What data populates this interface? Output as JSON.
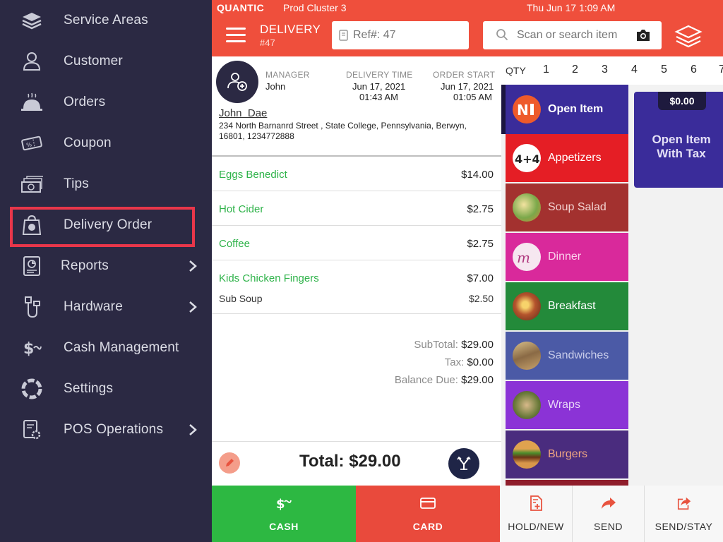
{
  "colors": {
    "sidebar_bg": "#2b2943",
    "header_bg": "#ef4f3c",
    "accent_green": "#2fb34a",
    "highlight_red": "#e8364a",
    "cash_green": "#2db842",
    "card_red": "#e94a3c"
  },
  "sidebar": {
    "items": [
      {
        "label": "Service Areas",
        "icon": "layers-icon",
        "chevron": false
      },
      {
        "label": "Customer",
        "icon": "user-icon",
        "chevron": false
      },
      {
        "label": "Orders",
        "icon": "cloche-icon",
        "chevron": false
      },
      {
        "label": "Coupon",
        "icon": "coupon-icon",
        "chevron": false
      },
      {
        "label": "Tips",
        "icon": "cash-stack-icon",
        "chevron": false
      },
      {
        "label": "Delivery Order",
        "icon": "delivery-bag-icon",
        "chevron": false,
        "highlighted": true
      },
      {
        "label": "Reports",
        "icon": "report-icon",
        "chevron": true
      },
      {
        "label": "Hardware",
        "icon": "plug-icon",
        "chevron": true
      },
      {
        "label": "Cash Management",
        "icon": "dollar-icon",
        "chevron": false
      },
      {
        "label": "Settings",
        "icon": "lifebuoy-icon",
        "chevron": false
      },
      {
        "label": "POS Operations",
        "icon": "pos-settings-icon",
        "chevron": true
      }
    ]
  },
  "status_bar": {
    "brand": "QUANTIC",
    "cluster": "Prod Cluster 3",
    "datetime": "Thu Jun 17 1:09 AM"
  },
  "header": {
    "mode": "DELIVERY",
    "order_number": "#47",
    "ref_placeholder": "Ref#: 47",
    "search_placeholder": "Scan or search item"
  },
  "order": {
    "manager_label": "MANAGER",
    "manager": "John",
    "delivery_time_label": "DELIVERY TIME",
    "delivery_date": "Jun 17, 2021",
    "delivery_time": "01:43 AM",
    "order_start_label": "ORDER START",
    "order_start_date": "Jun 17, 2021",
    "order_start_time": "01:05 AM",
    "customer_name": "John  Dae",
    "customer_address": "234 North Barnanrd Street , State College, Pennsylvania, Berwyn, 16801, 1234772888",
    "items": [
      {
        "name": "Eggs Benedict",
        "price": "$14.00"
      },
      {
        "name": "Hot Cider",
        "price": "$2.75"
      },
      {
        "name": "Coffee",
        "price": "$2.75"
      },
      {
        "name": "Kids Chicken Fingers",
        "price": "$7.00"
      }
    ],
    "modifier": {
      "name": "Sub Soup",
      "price": "$2.50"
    },
    "subtotal_label": "SubTotal:",
    "subtotal": "$29.00",
    "tax_label": "Tax:",
    "tax": "$0.00",
    "balance_label": "Balance Due:",
    "balance": "$29.00",
    "total": "Total: $29.00"
  },
  "qty": {
    "label": "QTY",
    "numbers": [
      "1",
      "2",
      "3",
      "4",
      "5",
      "6",
      "7"
    ]
  },
  "categories": [
    {
      "label": "Open Item",
      "bg": "#3a2c9a",
      "text": "#ffffff",
      "bold": true,
      "selected": true
    },
    {
      "label": "Appetizers",
      "bg": "#e51e25",
      "text": "#ffffff",
      "bold": false
    },
    {
      "label": "Soup Salad",
      "bg": "#a3312f",
      "text": "#f2d2d0",
      "bold": false
    },
    {
      "label": "Dinner",
      "bg": "#d9299b",
      "text": "#fbd3ec",
      "bold": false
    },
    {
      "label": "Breakfast",
      "bg": "#238a3a",
      "text": "#ffffff",
      "bold": false
    },
    {
      "label": "Sandwiches",
      "bg": "#4b5aa6",
      "text": "#c9cdea",
      "bold": false
    },
    {
      "label": "Wraps",
      "bg": "#8b33d6",
      "text": "#e7d6f7",
      "bold": false
    },
    {
      "label": "Burgers",
      "bg": "#4a2c7e",
      "text": "#f0a582",
      "bold": false
    }
  ],
  "item_tile": {
    "price": "$0.00",
    "label": "Open Item With Tax"
  },
  "actions": [
    {
      "label": "CASH",
      "icon": "cash-icon"
    },
    {
      "label": "CARD",
      "icon": "card-icon"
    },
    {
      "label": "HOLD/NEW",
      "icon": "hold-new-icon"
    },
    {
      "label": "SEND",
      "icon": "send-icon"
    },
    {
      "label": "SEND/STAY",
      "icon": "send-stay-icon"
    }
  ]
}
